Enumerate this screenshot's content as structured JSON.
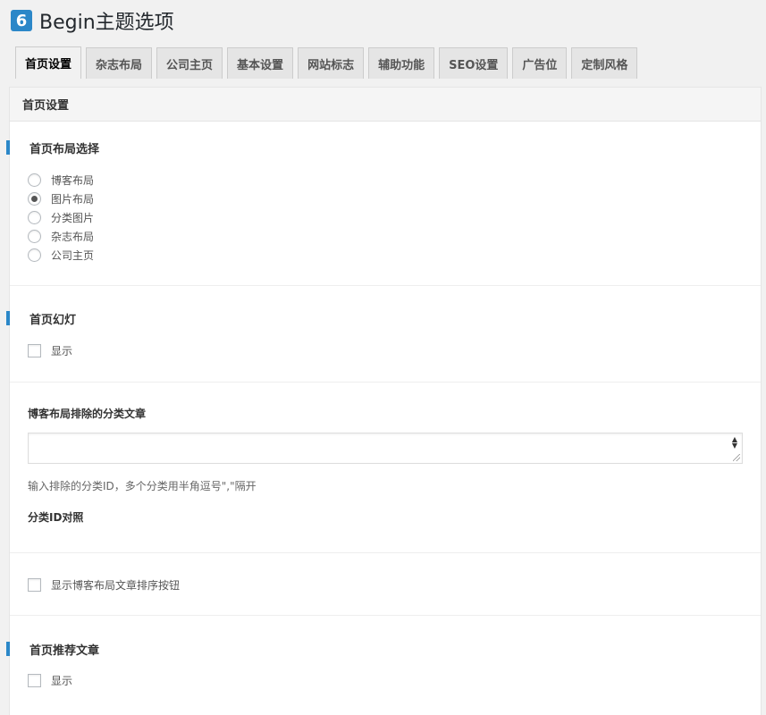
{
  "header": {
    "logo_glyph": "6",
    "title": "Begin主题选项"
  },
  "tabs": [
    {
      "label": "首页设置",
      "active": true
    },
    {
      "label": "杂志布局"
    },
    {
      "label": "公司主页"
    },
    {
      "label": "基本设置"
    },
    {
      "label": "网站标志"
    },
    {
      "label": "辅助功能"
    },
    {
      "label": "SEO设置"
    },
    {
      "label": "广告位"
    },
    {
      "label": "定制风格"
    }
  ],
  "panel": {
    "title": "首页设置",
    "layout": {
      "heading": "首页布局选择",
      "options": [
        "博客布局",
        "图片布局",
        "分类图片",
        "杂志布局",
        "公司主页"
      ],
      "selected": "图片布局"
    },
    "slideshow": {
      "heading": "首页幻灯",
      "checkbox_label": "显示",
      "checked": false
    },
    "exclude": {
      "heading": "博客布局排除的分类文章",
      "value": "",
      "description": "输入排除的分类ID，多个分类用半角逗号\",\"隔开",
      "id_reference": "分类ID对照"
    },
    "sort_button": {
      "checkbox_label": "显示博客布局文章排序按钮",
      "checked": false
    },
    "recommended": {
      "heading": "首页推荐文章",
      "checkbox_label": "显示",
      "checked": false
    }
  },
  "colors": {
    "accent": "#2b87c8"
  }
}
